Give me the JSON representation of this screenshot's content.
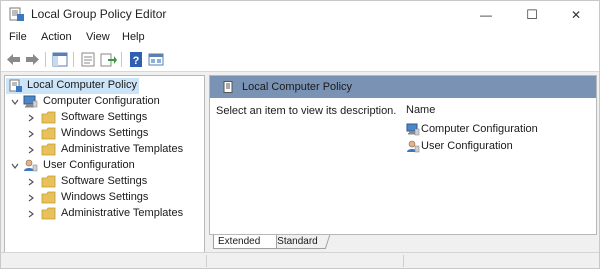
{
  "window": {
    "title": "Local Group Policy Editor"
  },
  "caption": {
    "minimize": "—",
    "maximize": "☐",
    "close": "✕"
  },
  "menu": {
    "items": [
      "File",
      "Action",
      "View",
      "Help"
    ]
  },
  "toolbar": {
    "buttons": [
      "back-arrow-icon",
      "forward-arrow-icon",
      "show-hide-console-tree-icon",
      "properties-icon",
      "export-list-icon",
      "help-icon",
      "mmc-view-icon"
    ]
  },
  "tree": {
    "root": "Local Computer Policy",
    "computer": {
      "label": "Computer Configuration",
      "children": [
        "Software Settings",
        "Windows Settings",
        "Administrative Templates"
      ]
    },
    "user": {
      "label": "User Configuration",
      "children": [
        "Software Settings",
        "Windows Settings",
        "Administrative Templates"
      ]
    }
  },
  "details": {
    "header_title": "Local Computer Policy",
    "description": "Select an item to view its description.",
    "column_name": "Name",
    "items": [
      "Computer Configuration",
      "User Configuration"
    ]
  },
  "tabs": {
    "extended": "Extended",
    "standard": "Standard",
    "active": "Extended"
  },
  "colors": {
    "header_bar": "#7a93b5",
    "selection": "#cce4f7",
    "folder": "#e8c15a"
  }
}
